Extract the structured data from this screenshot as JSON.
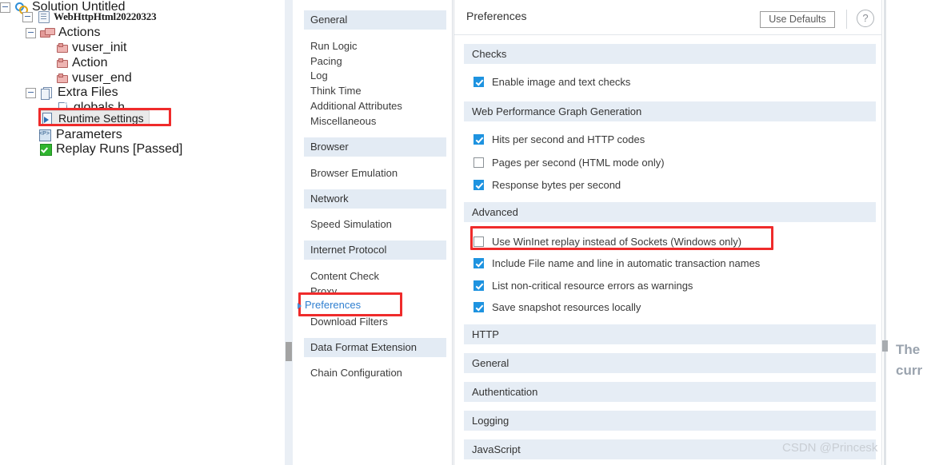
{
  "tree": {
    "nodes": [
      {
        "label": "Solution Untitled",
        "icon": "solution-icon"
      },
      {
        "label": "WebHttpHtml20220323",
        "icon": "script-icon"
      },
      {
        "label": "Actions",
        "icon": "bricks-icon"
      },
      {
        "label": "vuser_init",
        "icon": "brick-icon"
      },
      {
        "label": "Action",
        "icon": "brick-icon"
      },
      {
        "label": "vuser_end",
        "icon": "brick-icon"
      },
      {
        "label": "Extra Files",
        "icon": "files-icon"
      },
      {
        "label": "globals.h",
        "icon": "file-icon"
      },
      {
        "label": "Runtime Settings",
        "icon": "runtime-settings-icon"
      },
      {
        "label": "Parameters",
        "icon": "parameters-icon"
      },
      {
        "label": "Replay Runs [Passed]",
        "icon": "green-check-icon"
      }
    ]
  },
  "nav": {
    "groups": [
      {
        "title": "General",
        "items": [
          "Run Logic",
          "Pacing",
          "Log",
          "Think Time",
          "Additional Attributes",
          "Miscellaneous"
        ]
      },
      {
        "title": "Browser",
        "items": [
          "Browser Emulation"
        ]
      },
      {
        "title": "Network",
        "items": [
          "Speed Simulation"
        ]
      },
      {
        "title": "Internet Protocol",
        "items": [
          "Content Check",
          "Proxy",
          "Preferences",
          "Download Filters"
        ]
      },
      {
        "title": "Data Format Extension",
        "items": [
          "Chain Configuration"
        ]
      }
    ],
    "active_item": "Preferences"
  },
  "main": {
    "title": "Preferences",
    "use_defaults_label": "Use Defaults",
    "help_label": "?",
    "sections": [
      {
        "title": "Checks",
        "options": [
          {
            "label": "Enable image and text checks",
            "checked": true
          }
        ]
      },
      {
        "title": "Web Performance Graph Generation",
        "options": [
          {
            "label": "Hits per second and HTTP codes",
            "checked": true
          },
          {
            "label": "Pages per second (HTML mode only)",
            "checked": false
          },
          {
            "label": "Response bytes per second",
            "checked": true
          }
        ]
      },
      {
        "title": "Advanced",
        "options": [
          {
            "label": "Use WinInet replay instead of Sockets (Windows only)",
            "checked": false
          },
          {
            "label": "Include File name and line in automatic transaction names",
            "checked": true
          },
          {
            "label": "List non-critical resource errors as warnings",
            "checked": true
          },
          {
            "label": "Save snapshot resources locally",
            "checked": true
          }
        ]
      },
      {
        "title": "HTTP",
        "options": []
      },
      {
        "title": "General",
        "options": []
      },
      {
        "title": "Authentication",
        "options": []
      },
      {
        "title": "Logging",
        "options": []
      },
      {
        "title": "JavaScript",
        "options": []
      }
    ]
  },
  "overflow": {
    "line1": "The",
    "line2": "curr"
  },
  "watermark": "CSDN @Princesk",
  "colors": {
    "accent": "#1e93e0",
    "section_header_bg": "#e6edf5",
    "annotation_red": "#ef2b2b",
    "nav_active": "#2f7fd0"
  }
}
